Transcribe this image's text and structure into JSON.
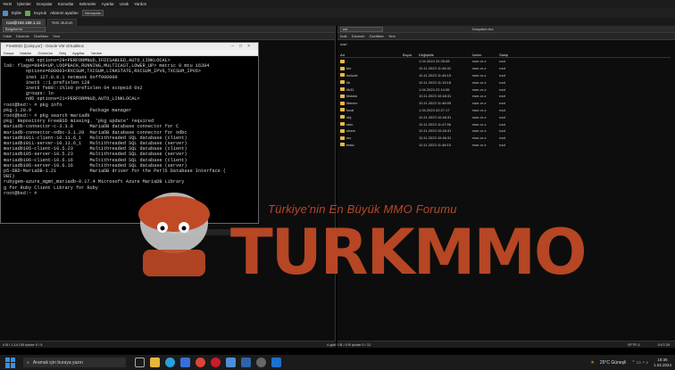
{
  "menubar": [
    "Yerel",
    "İşlemler",
    "Dosyalar",
    "Komutlar",
    "Sekmeler",
    "Ayarlar",
    "Uzak",
    "Yardım"
  ],
  "toolbar": {
    "items": [
      "Eşitle",
      "Kuyruk",
      "Aktarım ayarları"
    ],
    "preset": "Varsayılan"
  },
  "session_tabs": [
    {
      "label": "root@192.168.1.12",
      "active": true
    },
    {
      "label": "Yeni oturum",
      "active": false
    }
  ],
  "left_panel": {
    "path": "Belgelerim",
    "actions": [
      "Yükle",
      "Düzenle",
      "Özellikler",
      "Yeni"
    ]
  },
  "vm_window": {
    "title": "FreeBSD [Çalışıyor] - Oracle VM VirtualBox",
    "menu": [
      "Dosya",
      "Makine",
      "Görünüm",
      "Giriş",
      "Aygıtlar",
      "Yardım"
    ],
    "terminal_lines": [
      "        nd6 options=29<PERFORMNUD,IFDISABLED,AUTO_LINKLOCAL>",
      "lo0: flags=8049<UP,LOOPBACK,RUNNING,MULTICAST,LOWER_UP> metric 0 mtu 16384",
      "        options=680003<RXCSUM,TXCSUM,LINKSTATE,RXCSUM_IPV6,TXCSUM_IPV6>",
      "        inet 127.0.0.1 netmask 0xff000000",
      "        inet6 ::1 prefixlen 128",
      "        inet6 fe80::1%lo0 prefixlen 64 scopeid 0x2",
      "        groups: lo",
      "        nd6 options=21<PERFORMNUD,AUTO_LINKLOCAL>",
      "root@bsd:~ # pkg info",
      "pkg-1.20.9                     Package manager",
      "root@bsd:~ # pkg search mariadb",
      "pkg: Repository FreeBSD missing. 'pkg update' required",
      "mariadb-connector-c-3.3.8      MariaDB database connector for C",
      "mariadb-connector-odbc-3.1.20  MariaDB database connector for odbc",
      "mariadb1011-client-10.11.6_1   Multithreaded SQL database (client)",
      "mariadb1011-server-10.11.6_1   Multithreaded SQL database (server)",
      "mariadb105-client-10.5.23      Multithreaded SQL database (client)",
      "mariadb105-server-10.5.23      Multithreaded SQL database (server)",
      "mariadb106-client-10.6.16      Multithreaded SQL database (client)",
      "mariadb106-server-10.6.16      Multithreaded SQL database (server)",
      "p5-DBD-MariaDB-1.21            MariaDB driver for the Perl5 Database Interface (",
      "DBI)",
      "rubygem-azure_mgmt_mariadb-0.17.4 Microsoft Azure MariaDB Library",
      "g for Ruby Client Library for Ruby",
      "root@bsd:~ # "
    ],
    "status": "Right Control"
  },
  "right_panel": {
    "path": "usr",
    "actions": [
      "İndir",
      "Düzenle",
      "Özellikler",
      "Yeni"
    ],
    "find_label": "Dosyaları bul",
    "current_dir": "/usr/",
    "columns": [
      "Ad",
      "Boyut",
      "Değişiklik",
      "İzinler",
      "Sahip"
    ],
    "files": [
      {
        "name": "..",
        "size": "",
        "modified": "1.04.2024 22:26:08",
        "perms": "rwxr-xr-x",
        "owner": "root"
      },
      {
        "name": "bin",
        "size": "",
        "modified": "10.11.2023 11:46:31",
        "perms": "rwxr-xr-x",
        "owner": "root"
      },
      {
        "name": "include",
        "size": "",
        "modified": "10.11.2023 11:46:15",
        "perms": "rwxr-xr-x",
        "owner": "root"
      },
      {
        "name": "lib",
        "size": "",
        "modified": "10.11.2023 11:15:18",
        "perms": "rwxr-xr-x",
        "owner": "root"
      },
      {
        "name": "lib32",
        "size": "",
        "modified": "1.04.2024 22:14:36",
        "perms": "rwxr-xr-x",
        "owner": "root"
      },
      {
        "name": "libdata",
        "size": "",
        "modified": "10.11.2023 10:48:31",
        "perms": "rwxr-xr-x",
        "owner": "root"
      },
      {
        "name": "libexec",
        "size": "",
        "modified": "10.11.2023 11:46:05",
        "perms": "rwxr-xr-x",
        "owner": "root"
      },
      {
        "name": "local",
        "size": "",
        "modified": "1.04.2024 22:27:17",
        "perms": "rwxr-xr-x",
        "owner": "root"
      },
      {
        "name": "obj",
        "size": "",
        "modified": "10.11.2023 10:46:31",
        "perms": "rwxr-xr-x",
        "owner": "root"
      },
      {
        "name": "sbin",
        "size": "",
        "modified": "10.11.2023 11:47:06",
        "perms": "rwxr-xr-x",
        "owner": "root"
      },
      {
        "name": "share",
        "size": "",
        "modified": "10.11.2023 10:46:31",
        "perms": "rwxr-xr-x",
        "owner": "root"
      },
      {
        "name": "src",
        "size": "",
        "modified": "10.11.2023 10:46:31",
        "perms": "rwxr-xr-x",
        "owner": "root"
      },
      {
        "name": "tests",
        "size": "",
        "modified": "10.11.2023 11:48:15",
        "perms": "rwxr-xr-x",
        "owner": "root"
      }
    ]
  },
  "watermark": {
    "tagline": "Türkiye'nin En Büyük MMO Forumu",
    "logo": "TURKMMO"
  },
  "status": {
    "left": "0 B / 1,14 GB içinde 0 / 5",
    "right_mid": "4 gizli  0 B / 0 B içinde 0 / 12",
    "protocol": "SFTP-3",
    "elapsed": "0:07:29"
  },
  "taskbar": {
    "search_placeholder": "Aramak için buraya yazın",
    "weather": "25°C  Güneşli",
    "time": "19:36",
    "date": "1.04.2024"
  }
}
